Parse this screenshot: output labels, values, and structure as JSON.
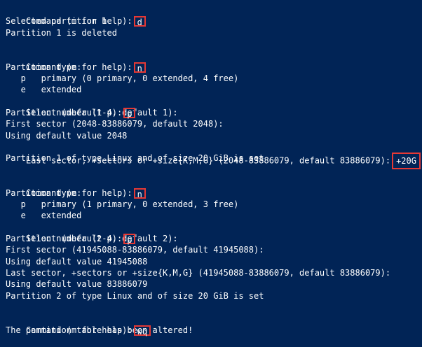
{
  "terminal": {
    "blocks": [
      {
        "lines": [
          {
            "prompt": "Command (m for help):",
            "input": "d"
          },
          {
            "text": "Selected partition 1"
          },
          {
            "text": "Partition 1 is deleted"
          }
        ]
      },
      {
        "lines": [
          {
            "prompt": "Command (m for help):",
            "input": "n"
          },
          {
            "text": "Partition type:"
          },
          {
            "text": "   p   primary (0 primary, 0 extended, 4 free)"
          },
          {
            "text": "   e   extended"
          },
          {
            "prompt": "Select (default p):",
            "input": "p"
          },
          {
            "text": "Partition number (1-4, default 1):"
          },
          {
            "text": "First sector (2048-83886079, default 2048):"
          },
          {
            "text": "Using default value 2048"
          },
          {
            "prompt": "Last sector, +sectors or +size{K,M,G} (2048-83886079, default 83886079):",
            "input": "+20G"
          },
          {
            "text": "Partition 1 of type Linux and of size 20 GiB is set"
          }
        ]
      },
      {
        "lines": [
          {
            "prompt": "Command (m for help):",
            "input": "n"
          },
          {
            "text": "Partition type:"
          },
          {
            "text": "   p   primary (1 primary, 0 extended, 3 free)"
          },
          {
            "text": "   e   extended"
          },
          {
            "prompt": "Select (default p):",
            "input": "p"
          },
          {
            "text": "Partition number (2-4, default 2):"
          },
          {
            "text": "First sector (41945088-83886079, default 41945088):"
          },
          {
            "text": "Using default value 41945088"
          },
          {
            "text": "Last sector, +sectors or +size{K,M,G} (41945088-83886079, default 83886079):"
          },
          {
            "text": "Using default value 83886079"
          },
          {
            "text": "Partition 2 of type Linux and of size 20 GiB is set"
          }
        ]
      },
      {
        "lines": [
          {
            "prompt": "Command (m for help):",
            "input": "wq"
          },
          {
            "text": "The partition table has been altered!"
          }
        ]
      }
    ],
    "colors": {
      "background": "#012456",
      "text": "#ffffff",
      "highlight_box": "#e53935"
    }
  }
}
